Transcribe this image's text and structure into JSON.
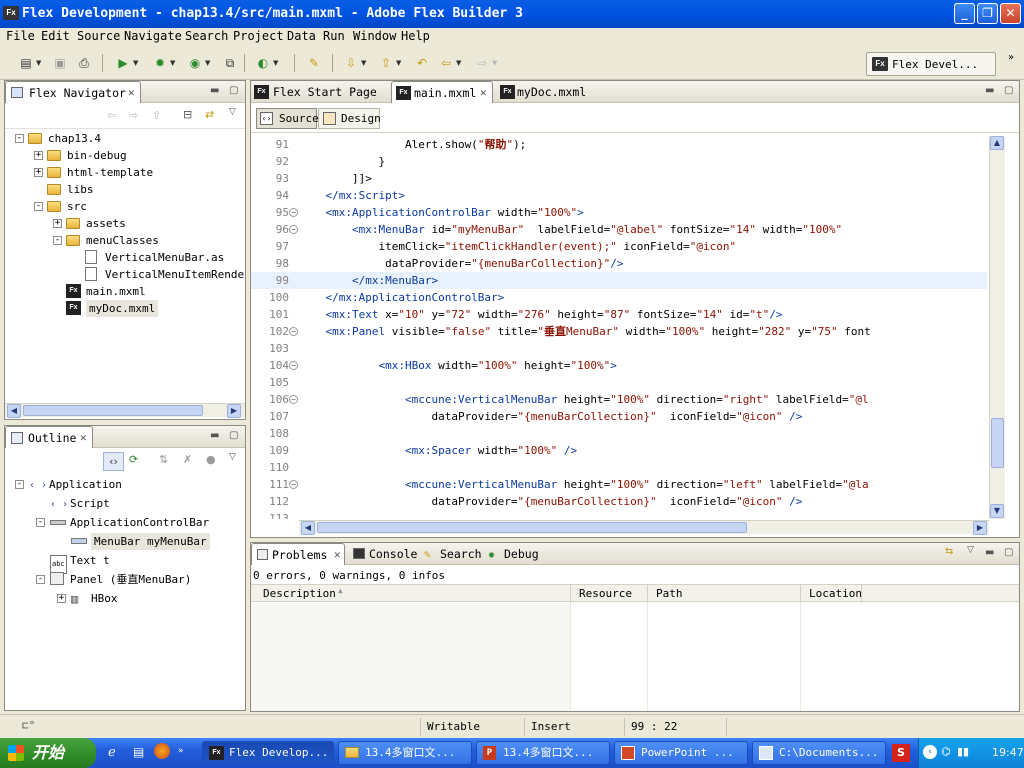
{
  "window": {
    "title": "Flex Development - chap13.4/src/main.mxml - Adobe Flex Builder 3",
    "app_icon": "Fx"
  },
  "menu": [
    "File",
    "Edit",
    "Source",
    "Navigate",
    "Search",
    "Project",
    "Data",
    "Run",
    "Window",
    "Help"
  ],
  "perspective": {
    "label": "Flex Devel..."
  },
  "navigator": {
    "title": "Flex Navigator",
    "tree": [
      {
        "label": "chap13.4",
        "level": 0,
        "type": "project",
        "exp": "-"
      },
      {
        "label": "bin-debug",
        "level": 1,
        "type": "folder",
        "exp": "+"
      },
      {
        "label": "html-template",
        "level": 1,
        "type": "folder",
        "exp": "+"
      },
      {
        "label": "libs",
        "level": 1,
        "type": "folder",
        "exp": ""
      },
      {
        "label": "src",
        "level": 1,
        "type": "folder",
        "exp": "-"
      },
      {
        "label": "assets",
        "level": 2,
        "type": "folder",
        "exp": "+"
      },
      {
        "label": "menuClasses",
        "level": 2,
        "type": "folder",
        "exp": "-"
      },
      {
        "label": "VerticalMenuBar.as",
        "level": 3,
        "type": "as",
        "exp": ""
      },
      {
        "label": "VerticalMenuItemRendere",
        "level": 3,
        "type": "as",
        "exp": ""
      },
      {
        "label": "main.mxml",
        "level": 2,
        "type": "mxml",
        "exp": ""
      },
      {
        "label": "myDoc.mxml",
        "level": 2,
        "type": "mxml",
        "exp": "",
        "selected": true
      }
    ]
  },
  "outline": {
    "title": "Outline",
    "tree": [
      {
        "label": "Application",
        "level": 0,
        "exp": "-",
        "icon": "<>"
      },
      {
        "label": "Script",
        "level": 1,
        "exp": "",
        "icon": "<>"
      },
      {
        "label": "ApplicationControlBar",
        "level": 1,
        "exp": "-",
        "icon": "bar"
      },
      {
        "label": "MenuBar myMenuBar",
        "level": 2,
        "exp": "",
        "icon": "menu",
        "selected": true
      },
      {
        "label": "Text t",
        "level": 1,
        "exp": "",
        "icon": "abc"
      },
      {
        "label": "Panel (垂直MenuBar)",
        "level": 1,
        "exp": "-",
        "icon": "panel"
      },
      {
        "label": "HBox",
        "level": 2,
        "exp": "+",
        "icon": "hbox"
      }
    ]
  },
  "editor": {
    "tabs": [
      {
        "label": "Flex Start Page",
        "active": false
      },
      {
        "label": "main.mxml",
        "active": true
      },
      {
        "label": "myDoc.mxml",
        "active": false
      }
    ],
    "modes": {
      "source": "Source",
      "design": "Design"
    },
    "lines": [
      {
        "n": "91",
        "fold": "",
        "hl": false,
        "parts": [
          [
            "atr",
            "                Alert.show("
          ],
          [
            "str",
            "\""
          ],
          [
            "strb",
            "帮助"
          ],
          [
            "str",
            "\""
          ],
          [
            "atr",
            ");"
          ]
        ]
      },
      {
        "n": "92",
        "fold": "",
        "hl": false,
        "parts": [
          [
            "atr",
            "            }"
          ]
        ]
      },
      {
        "n": "93",
        "fold": "",
        "hl": false,
        "parts": [
          [
            "atr",
            "        ]]>"
          ]
        ]
      },
      {
        "n": "94",
        "fold": "",
        "hl": false,
        "parts": [
          [
            "tag",
            "    </mx:Script>"
          ]
        ]
      },
      {
        "n": "95",
        "fold": "-",
        "hl": false,
        "parts": [
          [
            "tag",
            "    <mx:ApplicationControlBar"
          ],
          [
            "atr",
            " width="
          ],
          [
            "str",
            "\"100%\""
          ],
          [
            "tag",
            ">"
          ]
        ]
      },
      {
        "n": "96",
        "fold": "-",
        "hl": false,
        "parts": [
          [
            "tag",
            "        <mx:MenuBar"
          ],
          [
            "atr",
            " id="
          ],
          [
            "str",
            "\"myMenuBar\""
          ],
          [
            "atr",
            "  labelField="
          ],
          [
            "str",
            "\"@label\""
          ],
          [
            "atr",
            " fontSize="
          ],
          [
            "str",
            "\"14\""
          ],
          [
            "atr",
            " width="
          ],
          [
            "str",
            "\"100%\""
          ]
        ]
      },
      {
        "n": "97",
        "fold": "",
        "hl": false,
        "parts": [
          [
            "atr",
            "            itemClick="
          ],
          [
            "str",
            "\"itemClickHandler(event);\""
          ],
          [
            "atr",
            " iconField="
          ],
          [
            "str",
            "\"@icon\""
          ]
        ]
      },
      {
        "n": "98",
        "fold": "",
        "hl": false,
        "parts": [
          [
            "atr",
            "             dataProvider="
          ],
          [
            "str",
            "\"{menuBarCollection}\""
          ],
          [
            "tag",
            "/>"
          ]
        ]
      },
      {
        "n": "99",
        "fold": "",
        "hl": true,
        "parts": [
          [
            "tag",
            "        </mx:MenuBar>"
          ]
        ]
      },
      {
        "n": "100",
        "fold": "",
        "hl": false,
        "parts": [
          [
            "tag",
            "    </mx:ApplicationControlBar>"
          ]
        ]
      },
      {
        "n": "101",
        "fold": "",
        "hl": false,
        "parts": [
          [
            "tag",
            "    <mx:Text"
          ],
          [
            "atr",
            " x="
          ],
          [
            "str",
            "\"10\""
          ],
          [
            "atr",
            " y="
          ],
          [
            "str",
            "\"72\""
          ],
          [
            "atr",
            " width="
          ],
          [
            "str",
            "\"276\""
          ],
          [
            "atr",
            " height="
          ],
          [
            "str",
            "\"87\""
          ],
          [
            "atr",
            " fontSize="
          ],
          [
            "str",
            "\"14\""
          ],
          [
            "atr",
            " id="
          ],
          [
            "str",
            "\"t\""
          ],
          [
            "tag",
            "/>"
          ]
        ]
      },
      {
        "n": "102",
        "fold": "-",
        "hl": false,
        "parts": [
          [
            "tag",
            "    <mx:Panel"
          ],
          [
            "atr",
            " visible="
          ],
          [
            "str",
            "\"false\""
          ],
          [
            "atr",
            " title="
          ],
          [
            "str",
            "\""
          ],
          [
            "strb",
            "垂直"
          ],
          [
            "str",
            "MenuBar\""
          ],
          [
            "atr",
            " width="
          ],
          [
            "str",
            "\"100%\""
          ],
          [
            "atr",
            " height="
          ],
          [
            "str",
            "\"282\""
          ],
          [
            "atr",
            " y="
          ],
          [
            "str",
            "\"75\""
          ],
          [
            "atr",
            " font"
          ]
        ]
      },
      {
        "n": "103",
        "fold": "",
        "hl": false,
        "parts": [
          [
            "atr",
            ""
          ]
        ]
      },
      {
        "n": "104",
        "fold": "-",
        "hl": false,
        "parts": [
          [
            "tag",
            "            <mx:HBox"
          ],
          [
            "atr",
            " width="
          ],
          [
            "str",
            "\"100%\""
          ],
          [
            "atr",
            " height="
          ],
          [
            "str",
            "\"100%\""
          ],
          [
            "tag",
            ">"
          ]
        ]
      },
      {
        "n": "105",
        "fold": "",
        "hl": false,
        "parts": [
          [
            "atr",
            ""
          ]
        ]
      },
      {
        "n": "106",
        "fold": "-",
        "hl": false,
        "parts": [
          [
            "tag",
            "                <mccune:VerticalMenuBar"
          ],
          [
            "atr",
            " height="
          ],
          [
            "str",
            "\"100%\""
          ],
          [
            "atr",
            " direction="
          ],
          [
            "str",
            "\"right\""
          ],
          [
            "atr",
            " labelField="
          ],
          [
            "str",
            "\"@l"
          ]
        ]
      },
      {
        "n": "107",
        "fold": "",
        "hl": false,
        "parts": [
          [
            "atr",
            "                    dataProvider="
          ],
          [
            "str",
            "\"{menuBarCollection}\""
          ],
          [
            "atr",
            "  iconField="
          ],
          [
            "str",
            "\"@icon\""
          ],
          [
            "tag",
            " />"
          ]
        ]
      },
      {
        "n": "108",
        "fold": "",
        "hl": false,
        "parts": [
          [
            "atr",
            ""
          ]
        ]
      },
      {
        "n": "109",
        "fold": "",
        "hl": false,
        "parts": [
          [
            "tag",
            "                <mx:Spacer"
          ],
          [
            "atr",
            " width="
          ],
          [
            "str",
            "\"100%\""
          ],
          [
            "tag",
            " />"
          ]
        ]
      },
      {
        "n": "110",
        "fold": "",
        "hl": false,
        "parts": [
          [
            "atr",
            ""
          ]
        ]
      },
      {
        "n": "111",
        "fold": "-",
        "hl": false,
        "parts": [
          [
            "tag",
            "                <mccune:VerticalMenuBar"
          ],
          [
            "atr",
            " height="
          ],
          [
            "str",
            "\"100%\""
          ],
          [
            "atr",
            " direction="
          ],
          [
            "str",
            "\"left\""
          ],
          [
            "atr",
            " labelField="
          ],
          [
            "str",
            "\"@la"
          ]
        ]
      },
      {
        "n": "112",
        "fold": "",
        "hl": false,
        "parts": [
          [
            "atr",
            "                    dataProvider="
          ],
          [
            "str",
            "\"{menuBarCollection}\""
          ],
          [
            "atr",
            "  iconField="
          ],
          [
            "str",
            "\"@icon\""
          ],
          [
            "tag",
            " />"
          ]
        ]
      },
      {
        "n": "113",
        "fold": "",
        "hl": false,
        "parts": [
          [
            "atr",
            ""
          ]
        ]
      }
    ]
  },
  "bottom": {
    "tabs": [
      "Problems",
      "Console",
      "Search",
      "Debug"
    ],
    "summary": "0 errors, 0 warnings, 0 infos",
    "columns": [
      "Description",
      "Resource",
      "Path",
      "Location"
    ]
  },
  "status": {
    "writable": "Writable",
    "insert": "Insert",
    "position": "99 : 22"
  },
  "taskbar": {
    "start": "开始",
    "tasks": [
      "Flex Develop...",
      "13.4多窗口文...",
      "13.4多窗口文...",
      "PowerPoint ...",
      "C:\\Documents..."
    ],
    "clock": "19:47"
  },
  "colors": {
    "tag": "#0A3A9F",
    "string": "#8B1000",
    "title_bar": "#0054E3",
    "taskbar": "#245EDB",
    "start": "#2E8B27"
  }
}
